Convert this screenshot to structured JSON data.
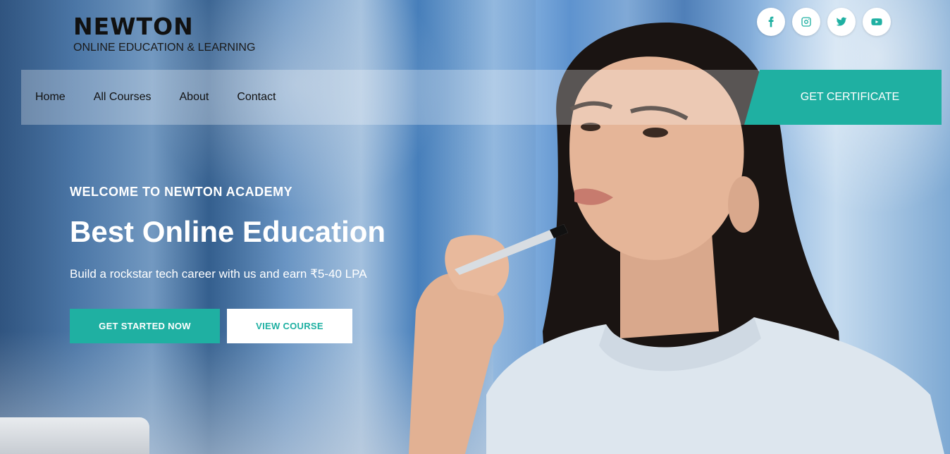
{
  "brand": {
    "title": "NEWTON",
    "subtitle": "ONLINE EDUCATION & LEARNING"
  },
  "social": [
    {
      "icon": "facebook-icon"
    },
    {
      "icon": "instagram-icon"
    },
    {
      "icon": "twitter-icon"
    },
    {
      "icon": "youtube-icon"
    }
  ],
  "nav": {
    "links": [
      "Home",
      "All Courses",
      "About",
      "Contact"
    ],
    "cta": "GET CERTIFICATE"
  },
  "hero": {
    "eyebrow": "WELCOME TO NEWTON ACADEMY",
    "headline": "Best Online Education",
    "subtext": "Build a rockstar tech career with us and earn ₹5-40 LPA",
    "primary_button": "GET STARTED NOW",
    "secondary_button": "VIEW COURSE"
  },
  "colors": {
    "accent": "#1fb0a2",
    "brand_text": "#111111"
  }
}
